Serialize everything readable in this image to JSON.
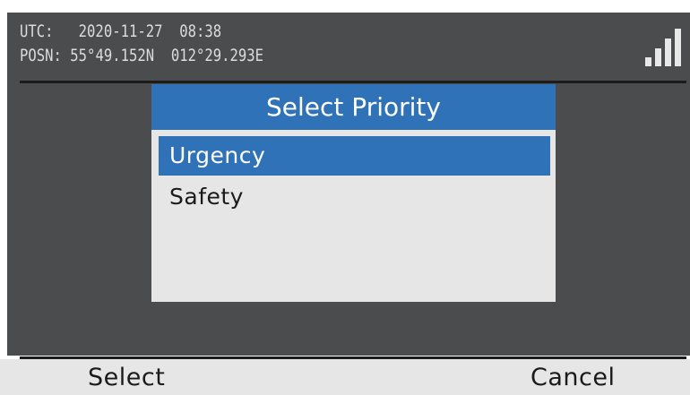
{
  "status": {
    "utc_label": "UTC:",
    "utc_value": "2020-11-27  08:38",
    "posn_label": "POSN:",
    "posn_value": "55°49.152N  012°29.293E",
    "signal_icon": "signal-strength-icon"
  },
  "dialog": {
    "title": "Select Priority",
    "options": [
      {
        "label": "Urgency",
        "selected": true
      },
      {
        "label": "Safety",
        "selected": false
      }
    ]
  },
  "softkeys": {
    "left": "Select",
    "right": "Cancel"
  },
  "colors": {
    "accent": "#2f72b8",
    "screen_bg": "#4b4c4e",
    "panel_bg": "#e6e6e6"
  }
}
